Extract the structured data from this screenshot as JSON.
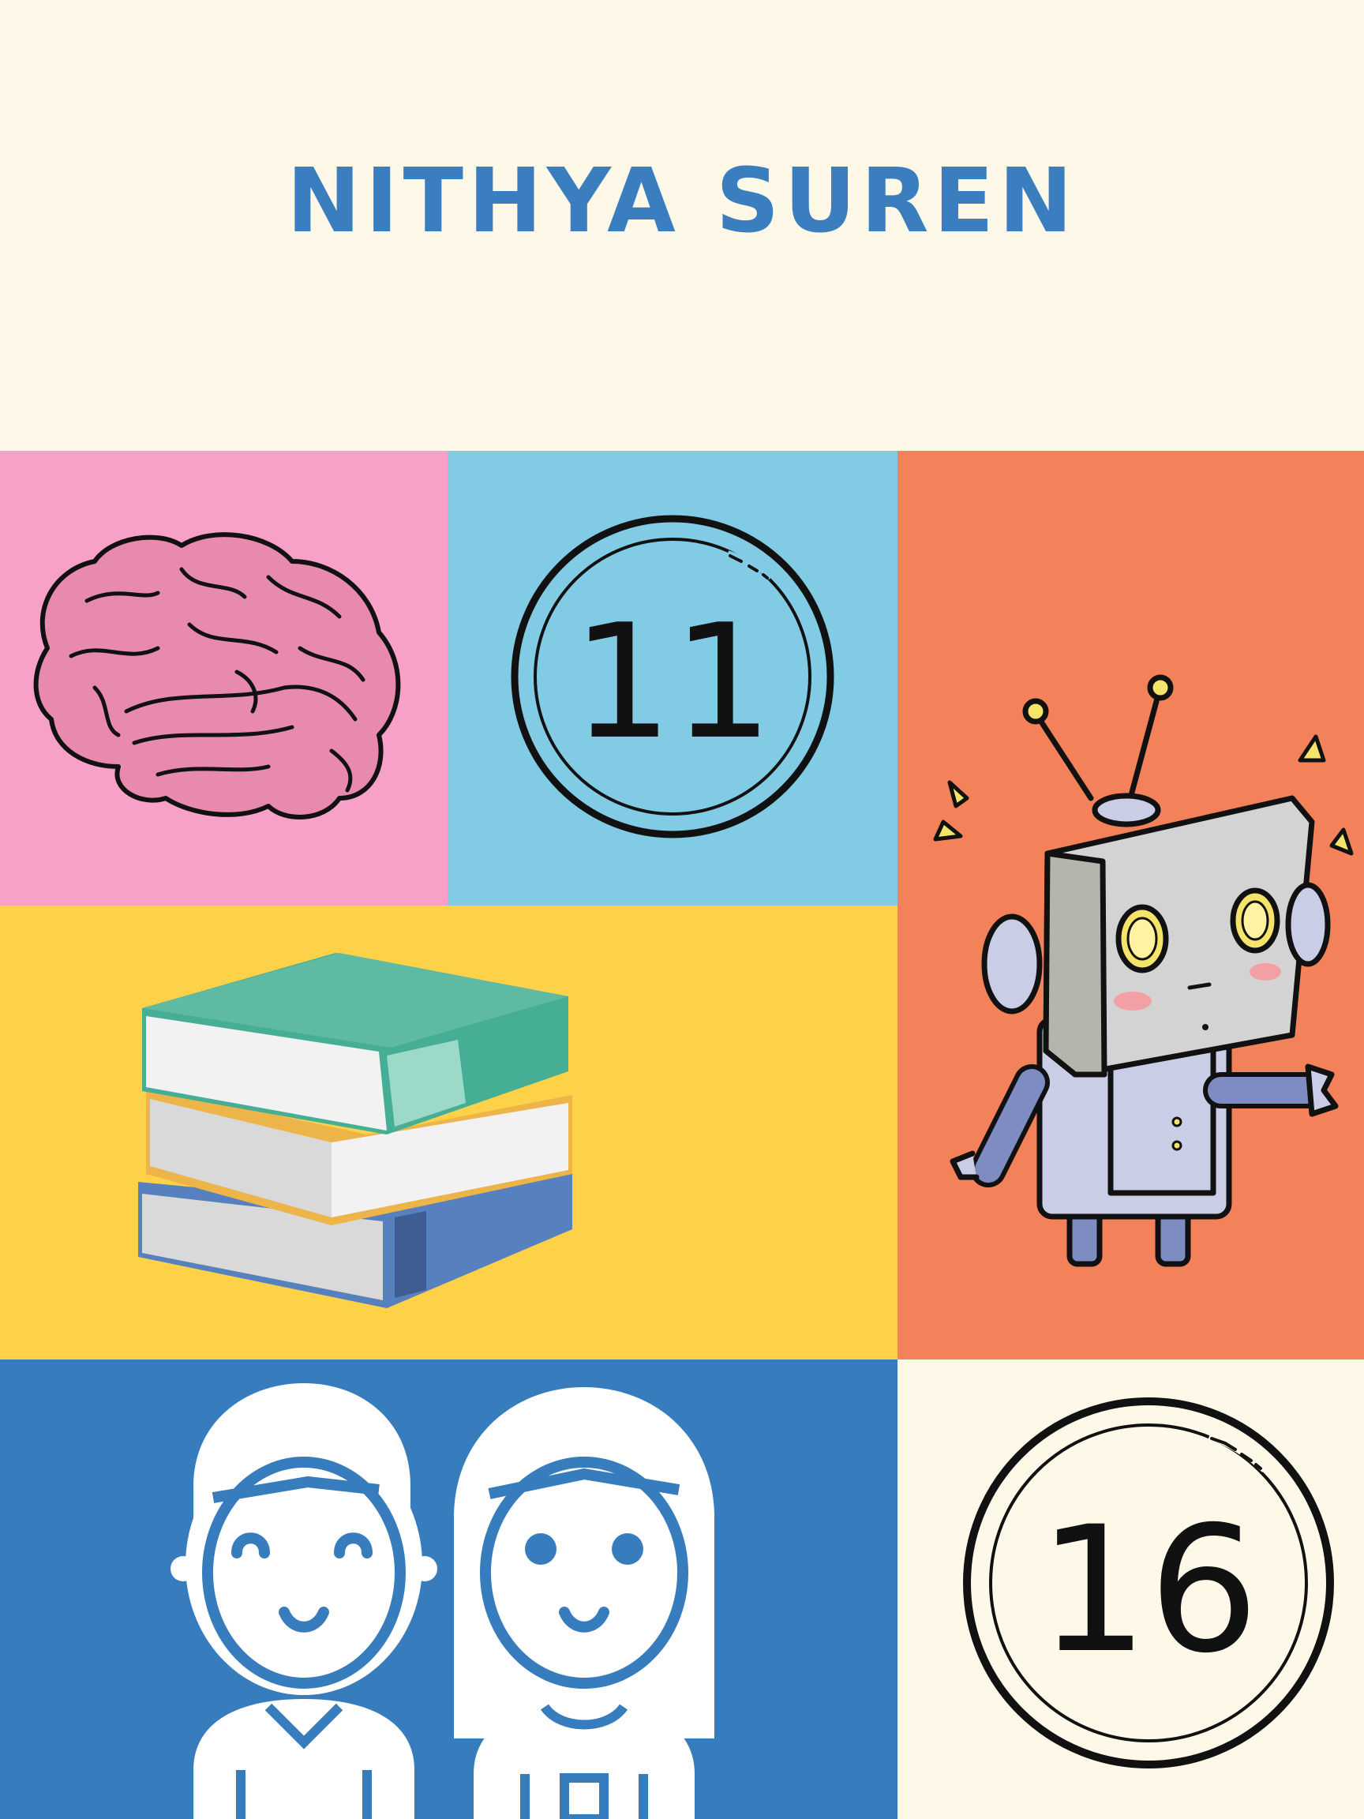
{
  "header": {
    "name": "NITHYA SUREN"
  },
  "tiles": {
    "brain": {
      "icon": "brain-icon",
      "color": "#F7A1C8"
    },
    "number_badge_1": {
      "value": "11",
      "color": "#82CBE5"
    },
    "robot": {
      "icon": "robot-icon",
      "color": "#F3825A"
    },
    "books": {
      "icon": "books-stack-icon",
      "color": "#FDD248"
    },
    "people": {
      "icon": "boy-girl-icon",
      "color": "#377CBC"
    },
    "number_badge_2": {
      "value": "16",
      "color": "#FEF8E8"
    }
  },
  "colors": {
    "title": "#3A7EBF",
    "page_background": "#FEF8E8"
  }
}
